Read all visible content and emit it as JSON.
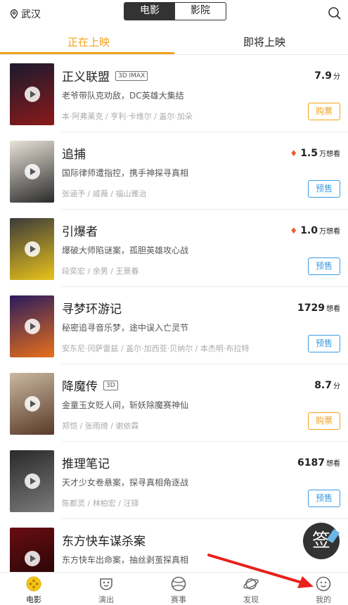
{
  "location": "武汉",
  "segments": [
    "电影",
    "影院"
  ],
  "tabs": [
    "正在上映",
    "即将上映"
  ],
  "movies": [
    {
      "title": "正义联盟",
      "badge": "3D IMAX",
      "desc": "老爷带队克劝敌，DC英雄大集结",
      "cast": "本·阿弗莱克 / 亨利·卡维尔 / 盖尔·加朵",
      "score": "7.9",
      "unit": "分",
      "button": "购票",
      "hot": false,
      "colors": [
        "#1a1a2e",
        "#8b1a1a"
      ]
    },
    {
      "title": "追捕",
      "badge": "",
      "desc": "国际律师遭指控，携手神探寻真相",
      "cast": "张涵予 / 戚薇 / 福山雅治",
      "score": "1.5",
      "unit": "万想看",
      "button": "预售",
      "hot": true,
      "colors": [
        "#e8e2d8",
        "#2b2b2b"
      ]
    },
    {
      "title": "引爆者",
      "badge": "",
      "desc": "爆破大师陷谜案，孤胆英雄攻心战",
      "cast": "段奕宏 / 余男 / 王景春",
      "score": "1.0",
      "unit": "万想看",
      "button": "预售",
      "hot": true,
      "colors": [
        "#3a3a3a",
        "#e9c21a"
      ]
    },
    {
      "title": "寻梦环游记",
      "badge": "",
      "desc": "秘密追寻音乐梦，途中误入亡灵节",
      "cast": "安东尼·冈萨雷兹 / 盖尔·加西亚·贝纳尔 / 本杰明·布拉特",
      "score": "1729",
      "unit": "想看",
      "button": "预售",
      "hot": false,
      "colors": [
        "#2a1b5e",
        "#e8701a"
      ]
    },
    {
      "title": "降魔传",
      "badge": "3D",
      "desc": "金童玉女贬人间，斩妖除魔赛神仙",
      "cast": "郑恺 / 张雨绮 / 谢依霖",
      "score": "8.7",
      "unit": "分",
      "button": "购票",
      "hot": false,
      "colors": [
        "#c9b8a0",
        "#5a3a2a"
      ]
    },
    {
      "title": "推理笔记",
      "badge": "",
      "desc": "天才少女卷悬案，探寻真相角逐战",
      "cast": "陈都灵 / 林柏宏 / 汪铎",
      "score": "6187",
      "unit": "想看",
      "button": "预售",
      "hot": false,
      "colors": [
        "#2a2a2a",
        "#7a7a7a"
      ]
    },
    {
      "title": "东方快车谋杀案",
      "badge": "",
      "desc": "东方快车出命案，抽丝剥茧探真相",
      "cast": "",
      "score": "",
      "unit": "",
      "button": "",
      "hot": false,
      "colors": [
        "#6a0d12",
        "#1a0505"
      ]
    }
  ],
  "nav": [
    {
      "label": "电影",
      "icon": "film-icon",
      "active": true
    },
    {
      "label": "演出",
      "icon": "mask-icon",
      "active": false
    },
    {
      "label": "赛事",
      "icon": "ball-icon",
      "active": false
    },
    {
      "label": "发现",
      "icon": "planet-icon",
      "active": false
    },
    {
      "label": "我的",
      "icon": "profile-icon",
      "active": false
    }
  ],
  "fab_label": "签",
  "accent": "#f2a31b",
  "presale_color": "#3c9be0"
}
